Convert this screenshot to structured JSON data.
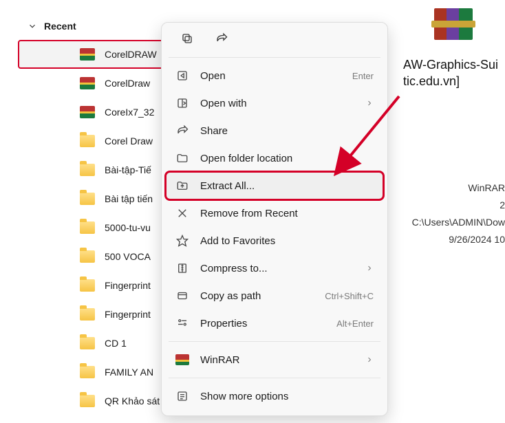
{
  "colors": {
    "annotation": "#d40027"
  },
  "sidebar": {
    "header": "Recent",
    "items": [
      {
        "label": "CorelDRAW",
        "icon": "rar",
        "selected": true
      },
      {
        "label": "CorelDraw",
        "icon": "rar"
      },
      {
        "label": "CoreIx7_32",
        "icon": "rar"
      },
      {
        "label": "Corel Draw",
        "icon": "folder"
      },
      {
        "label": "Bài-tập-Tiế",
        "icon": "folder"
      },
      {
        "label": "Bài tập tiến",
        "icon": "folder"
      },
      {
        "label": "5000-tu-vu",
        "icon": "folder"
      },
      {
        "label": "500 VOCA",
        "icon": "folder"
      },
      {
        "label": "Fingerprint",
        "icon": "folder"
      },
      {
        "label": "Fingerprint",
        "icon": "folder"
      },
      {
        "label": "CD 1",
        "icon": "folder"
      },
      {
        "label": "FAMILY AN",
        "icon": "folder"
      },
      {
        "label": "QR Khảo sát",
        "icon": "folder"
      }
    ]
  },
  "context_menu": {
    "open": {
      "label": "Open",
      "hint": "Enter"
    },
    "open_with": {
      "label": "Open with",
      "chevron": true
    },
    "share": {
      "label": "Share"
    },
    "open_location": {
      "label": "Open folder location"
    },
    "extract_all": {
      "label": "Extract All..."
    },
    "remove_recent": {
      "label": "Remove from Recent"
    },
    "add_favorites": {
      "label": "Add to Favorites"
    },
    "compress_to": {
      "label": "Compress to...",
      "chevron": true
    },
    "copy_as_path": {
      "label": "Copy as path",
      "hint": "Ctrl+Shift+C"
    },
    "properties": {
      "label": "Properties",
      "hint": "Alt+Enter"
    },
    "winrar": {
      "label": "WinRAR",
      "chevron": true
    },
    "show_more": {
      "label": "Show more options"
    }
  },
  "details": {
    "filename_line1": "AW-Graphics-Sui",
    "filename_line2": "tic.edu.vn]",
    "type": "WinRAR",
    "count": "2",
    "path": "C:\\Users\\ADMIN\\Dow",
    "modified": "9/26/2024 10"
  }
}
